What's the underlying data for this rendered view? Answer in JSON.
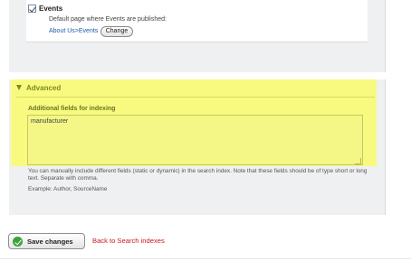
{
  "events": {
    "checkbox_checked": true,
    "label": "Events",
    "default_page_text": "Default page where Events are published:",
    "page_path": "About Us>Events",
    "change_label": "Change"
  },
  "advanced": {
    "header": "Advanced",
    "fields_label": "Additional fields for indexing",
    "fields_value": "manufacturer",
    "help_text": "You can manually include different fields (static or dynamic) in the search index. Note that these fields should be of type short or long text. Separate with comma.",
    "example_text": "Example: Author, SourceName",
    "highlight_color": "#f8fa80"
  },
  "actions": {
    "save_label": "Save changes",
    "save_icon": "check-circle-icon",
    "back_link": "Back to Search indexes",
    "back_link_color": "#d0161c"
  }
}
